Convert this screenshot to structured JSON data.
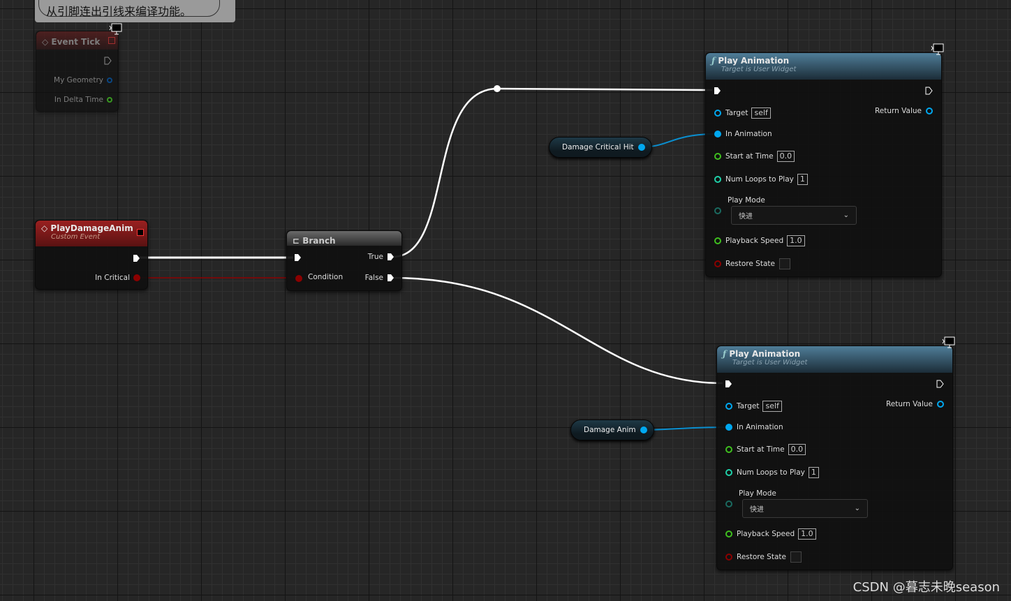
{
  "comment": {
    "text": "从引脚连出引线来编译功能。"
  },
  "event_tick": {
    "title": "Event Tick",
    "pins": [
      "My Geometry",
      "In Delta Time"
    ]
  },
  "custom_event": {
    "title": "PlayDamageAnim",
    "subtitle": "Custom Event",
    "pin": "In Critical"
  },
  "branch": {
    "title": "Branch",
    "condition": "Condition",
    "true_label": "True",
    "false_label": "False"
  },
  "variables": [
    {
      "label": "Damage Critical Hit"
    },
    {
      "label": "Damage Anim"
    }
  ],
  "play_nodes": [
    {
      "title": "Play Animation",
      "subtitle": "Target is User Widget",
      "target_label": "Target",
      "target_value": "self",
      "return_label": "Return Value",
      "in_anim": "In Animation",
      "start_label": "Start at Time",
      "start_value": "0.0",
      "loops_label": "Num Loops to Play",
      "loops_value": "1",
      "mode_label": "Play Mode",
      "mode_value": "快进",
      "speed_label": "Playback Speed",
      "speed_value": "1.0",
      "restore_label": "Restore State"
    },
    {
      "title": "Play Animation",
      "subtitle": "Target is User Widget",
      "target_label": "Target",
      "target_value": "self",
      "return_label": "Return Value",
      "in_anim": "In Animation",
      "start_label": "Start at Time",
      "start_value": "0.0",
      "loops_label": "Num Loops to Play",
      "loops_value": "1",
      "mode_label": "Play Mode",
      "mode_value": "快进",
      "speed_label": "Playback Speed",
      "speed_value": "1.0",
      "restore_label": "Restore State"
    }
  ],
  "watermark": "CSDN @暮志未晚season",
  "colors": {
    "exec": "#ffffff",
    "bool": "#8c0000",
    "object": "#00a8f0",
    "float": "#3fbf1f",
    "int": "#1fd0a8",
    "struct": "#0050a0",
    "event_header": "#7a1414",
    "function_header": "#3f6f8c"
  }
}
